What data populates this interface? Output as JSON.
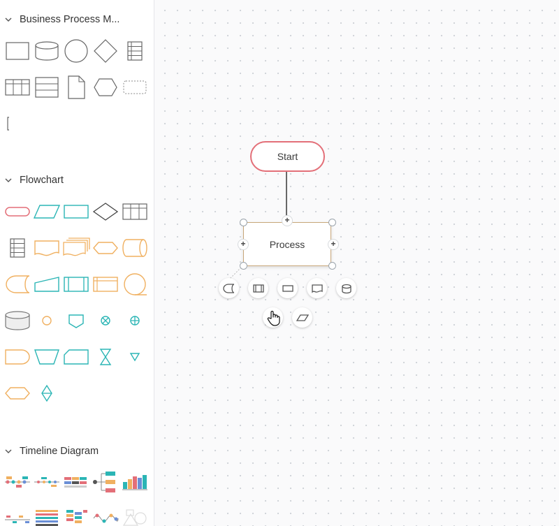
{
  "sidebar": {
    "sections": [
      {
        "title": "Business Process M..."
      },
      {
        "title": "Flowchart"
      },
      {
        "title": "Timeline Diagram"
      }
    ],
    "bpm_shapes": [
      "rectangle",
      "database",
      "circle",
      "diamond",
      "table",
      "table-wide",
      "list",
      "document",
      "hexagon",
      "dashed-rounded-rect",
      "bracket"
    ],
    "flowchart_shapes": [
      "terminator",
      "data",
      "process",
      "decision",
      "internal-storage",
      "internal-storage-grid",
      "document",
      "multiple-documents",
      "preparation",
      "direct-access-storage",
      "delay",
      "manual-input",
      "predefined-process",
      "internal-storage-alt",
      "sequential-data",
      "database",
      "connector",
      "off-page-connector",
      "summing-junction",
      "or",
      "display",
      "manual-operation",
      "card",
      "collate",
      "merge",
      "hexagon",
      "sort"
    ],
    "timeline_shapes": [
      "timeline-1",
      "timeline-2",
      "timeline-3",
      "timeline-4",
      "timeline-5",
      "timeline-6",
      "timeline-7",
      "timeline-8",
      "timeline-9",
      "timeline-10"
    ]
  },
  "canvas": {
    "start_label": "Start",
    "process_label": "Process",
    "quick_add_shapes": [
      "delay",
      "predefined-process",
      "process",
      "document",
      "database",
      "data"
    ]
  },
  "colors": {
    "red": "#e36f78",
    "teal": "#2bb5b5",
    "orange": "#f0b060",
    "gray": "#555555"
  }
}
